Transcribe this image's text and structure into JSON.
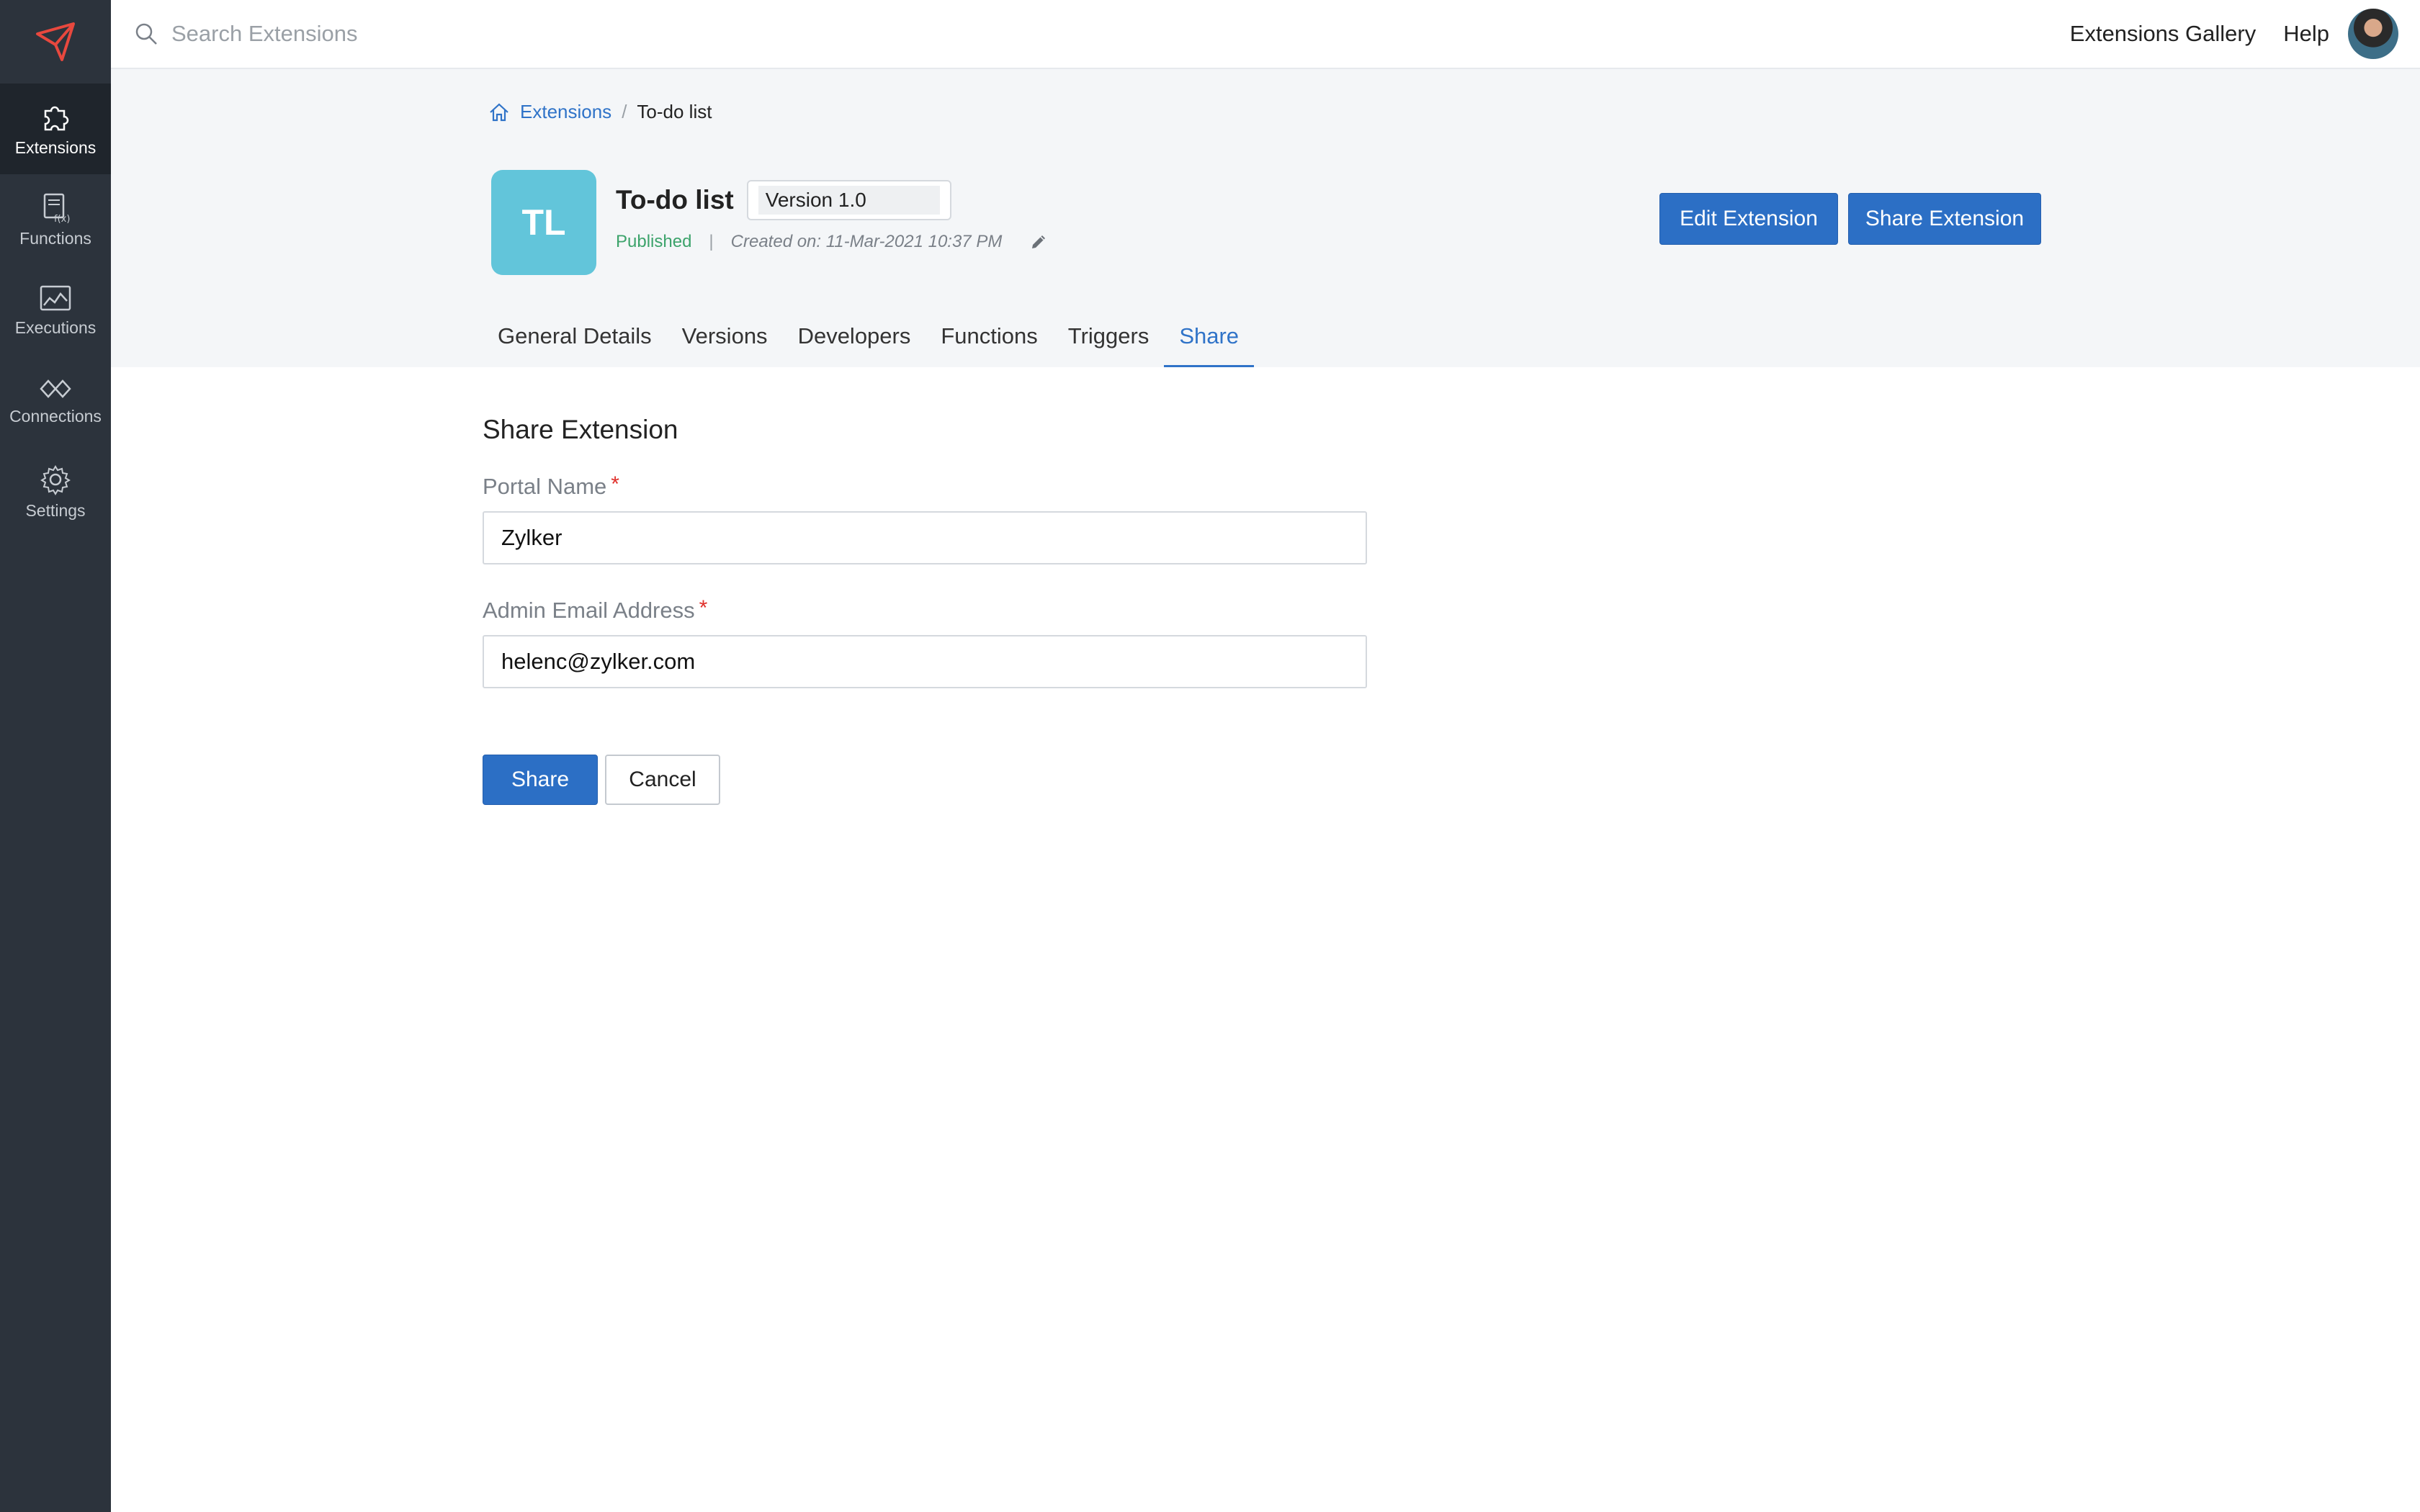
{
  "sidebar": {
    "logo_icon": "zoho-flow-arrow-icon",
    "items": [
      {
        "label": "Extensions",
        "icon": "puzzle-icon",
        "active": true
      },
      {
        "label": "Functions",
        "icon": "function-icon",
        "active": false
      },
      {
        "label": "Executions",
        "icon": "executions-chart-icon",
        "active": false
      },
      {
        "label": "Connections",
        "icon": "connections-link-icon",
        "active": false
      },
      {
        "label": "Settings",
        "icon": "gear-icon",
        "active": false
      }
    ]
  },
  "topbar": {
    "search_placeholder": "Search Extensions",
    "links": [
      "Extensions Gallery",
      "Help"
    ]
  },
  "breadcrumb": {
    "root": "Extensions",
    "separator": "/",
    "current": "To-do list"
  },
  "extension": {
    "initials": "TL",
    "title": "To-do list",
    "version": "Version 1.0",
    "status": "Published",
    "meta_separator": "|",
    "created": "Created on: 11-Mar-2021 10:37 PM"
  },
  "actions": {
    "edit": "Edit Extension",
    "share": "Share Extension"
  },
  "tabs": [
    "General Details",
    "Versions",
    "Developers",
    "Functions",
    "Triggers",
    "Share"
  ],
  "active_tab": "Share",
  "form": {
    "title": "Share Extension",
    "portal_label": "Portal Name",
    "portal_value": "Zylker",
    "email_label": "Admin Email Address",
    "email_value": "helenc@zylker.com",
    "required_mark": "*",
    "share_button": "Share",
    "cancel_button": "Cancel"
  },
  "colors": {
    "sidebar_bg": "#2c333c",
    "accent": "#2c6fc5",
    "tile": "#62c5da",
    "published": "#3ca36b",
    "required": "#e0312c"
  }
}
